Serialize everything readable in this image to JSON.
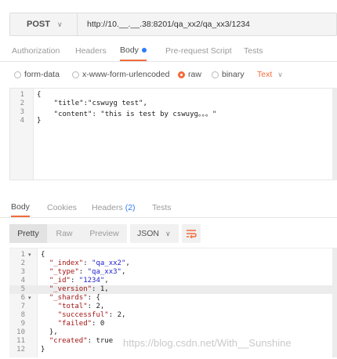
{
  "request": {
    "method": "POST",
    "url": "http://10.__.__.38:8201/qa_xx2/qa_xx3/1234",
    "tabs": [
      {
        "label": "Authorization",
        "active": false
      },
      {
        "label": "Headers",
        "active": false
      },
      {
        "label": "Body",
        "active": true
      },
      {
        "label": "Pre-request Script",
        "active": false
      },
      {
        "label": "Tests",
        "active": false
      }
    ],
    "body_types": [
      {
        "label": "form-data",
        "selected": false
      },
      {
        "label": "x-www-form-urlencoded",
        "selected": false
      },
      {
        "label": "raw",
        "selected": true
      },
      {
        "label": "binary",
        "selected": false
      }
    ],
    "content_type": "Text",
    "code": [
      {
        "ln": "1",
        "text": "{"
      },
      {
        "ln": "2",
        "text": "    \"title\":\"cswuyg test\","
      },
      {
        "ln": "3",
        "text": "    \"content\": \"this is test by cswuyg。。。\""
      },
      {
        "ln": "4",
        "text": "}"
      }
    ]
  },
  "response": {
    "tabs": [
      {
        "label": "Body",
        "active": true
      },
      {
        "label": "Cookies",
        "active": false
      },
      {
        "label": "Headers",
        "count": "(2)",
        "active": false
      },
      {
        "label": "Tests",
        "active": false
      }
    ],
    "views": [
      {
        "label": "Pretty",
        "active": true
      },
      {
        "label": "Raw",
        "active": false
      },
      {
        "label": "Preview",
        "active": false
      }
    ],
    "format": "JSON",
    "lines": [
      {
        "ln": "1",
        "fold": true,
        "indent": "",
        "key": "",
        "val": "{",
        "tail": ""
      },
      {
        "ln": "2",
        "fold": false,
        "indent": "  ",
        "key": "\"_index\"",
        "val": "\"qa_xx2\"",
        "tail": ","
      },
      {
        "ln": "3",
        "fold": false,
        "indent": "  ",
        "key": "\"_type\"",
        "val": "\"qa_xx3\"",
        "tail": ","
      },
      {
        "ln": "4",
        "fold": false,
        "indent": "  ",
        "key": "\"_id\"",
        "val": "\"1234\"",
        "tail": ","
      },
      {
        "ln": "5",
        "fold": false,
        "indent": "  ",
        "key": "\"_version\"",
        "val": "1",
        "tail": ","
      },
      {
        "ln": "6",
        "fold": true,
        "indent": "  ",
        "key": "\"_shards\"",
        "val": "{",
        "tail": ""
      },
      {
        "ln": "7",
        "fold": false,
        "indent": "    ",
        "key": "\"total\"",
        "val": "2",
        "tail": ","
      },
      {
        "ln": "8",
        "fold": false,
        "indent": "    ",
        "key": "\"successful\"",
        "val": "2",
        "tail": ","
      },
      {
        "ln": "9",
        "fold": false,
        "indent": "    ",
        "key": "\"failed\"",
        "val": "0",
        "tail": ""
      },
      {
        "ln": "10",
        "fold": false,
        "indent": "  ",
        "key": "",
        "val": "},",
        "tail": ""
      },
      {
        "ln": "11",
        "fold": false,
        "indent": "  ",
        "key": "\"created\"",
        "val": "true",
        "tail": ""
      },
      {
        "ln": "12",
        "fold": false,
        "indent": "",
        "key": "",
        "val": "}",
        "tail": ""
      }
    ],
    "highlighted_line": "5"
  },
  "watermark": "https://blog.csdn.net/With__Sunshine",
  "colors": {
    "accent": "#f26b3a",
    "link": "#2f7cf6",
    "json_key": "#a31515",
    "json_string": "#2222cc"
  }
}
